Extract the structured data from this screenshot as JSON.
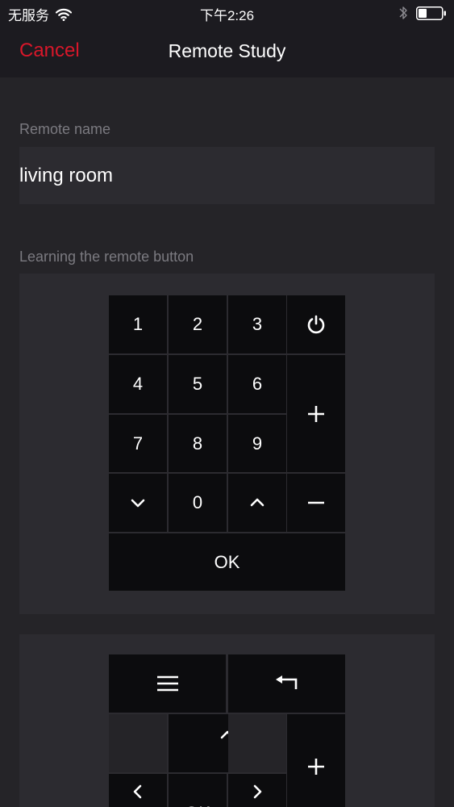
{
  "status_bar": {
    "carrier": "无服务",
    "time": "下午2:26"
  },
  "nav": {
    "cancel_label": "Cancel",
    "title": "Remote Study"
  },
  "form": {
    "remote_name_label": "Remote name",
    "remote_name_value": "living room",
    "learning_label": "Learning the remote button"
  },
  "keypad": {
    "digits": [
      "1",
      "2",
      "3",
      "4",
      "5",
      "6",
      "7",
      "8",
      "9"
    ],
    "zero": "0",
    "ok": "OK",
    "icons": {
      "power": "power-icon",
      "volume_up": "plus-icon",
      "volume_down": "minus-icon",
      "channel_down": "chevron-down-icon",
      "channel_up": "chevron-up-icon"
    }
  },
  "navpad": {
    "ok": "OK",
    "icons": {
      "menu": "menu-icon",
      "back": "return-icon",
      "up": "chevron-up-icon",
      "left": "chevron-left-icon",
      "right": "chevron-right-icon",
      "plus": "plus-icon"
    }
  },
  "colors": {
    "background": "#252428",
    "bar": "#1c1b20",
    "panel": "#2c2b30",
    "key": "#0c0c0e",
    "accent": "#d9172a",
    "label": "#7b7a80"
  }
}
